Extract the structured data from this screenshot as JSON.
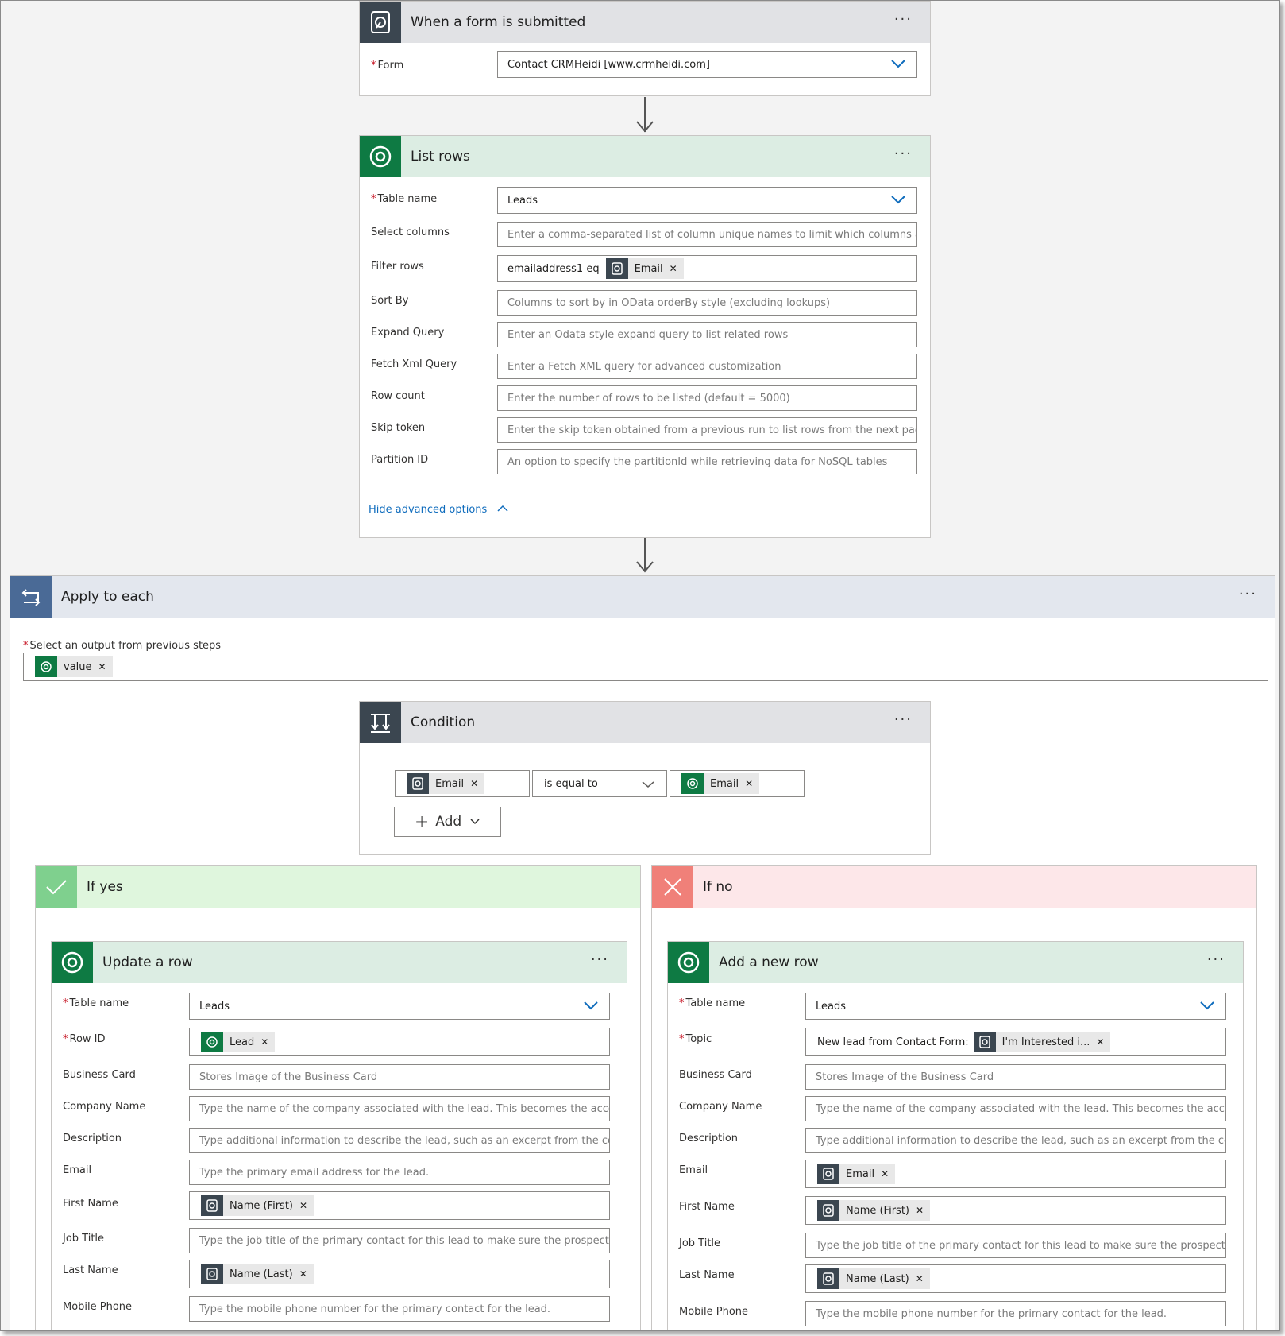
{
  "trigger": {
    "title": "When a form is submitted",
    "form_label": "Form",
    "form_value": "Contact CRMHeidi [www.crmheidi.com]"
  },
  "list_rows": {
    "title": "List rows",
    "table_label": "Table name",
    "table_value": "Leads",
    "select_columns_label": "Select columns",
    "select_columns_ph": "Enter a comma-separated list of column unique names to limit which columns a",
    "filter_label": "Filter rows",
    "filter_text": "emailaddress1 eq",
    "filter_token": "Email",
    "sort_label": "Sort By",
    "sort_ph": "Columns to sort by in OData orderBy style (excluding lookups)",
    "expand_label": "Expand Query",
    "expand_ph": "Enter an Odata style expand query to list related rows",
    "fetch_label": "Fetch Xml Query",
    "fetch_ph": "Enter a Fetch XML query for advanced customization",
    "rowcount_label": "Row count",
    "rowcount_ph": "Enter the number of rows to be listed (default = 5000)",
    "skip_label": "Skip token",
    "skip_ph": "Enter the skip token obtained from a previous run to list rows from the next pag",
    "partition_label": "Partition ID",
    "partition_ph": "An option to specify the partitionId while retrieving data for NoSQL tables",
    "hide_advanced": "Hide advanced options"
  },
  "apply": {
    "title": "Apply to each",
    "select_label": "Select an output from previous steps",
    "value_token": "value"
  },
  "condition": {
    "title": "Condition",
    "left_token": "Email",
    "operator": "is equal to",
    "right_token": "Email",
    "add_label": "Add"
  },
  "if_yes": {
    "title": "If yes",
    "update": {
      "title": "Update a row",
      "table_label": "Table name",
      "table_value": "Leads",
      "rowid_label": "Row ID",
      "rowid_token": "Lead",
      "bcard_label": "Business Card",
      "bcard_ph": "Stores Image of the Business Card",
      "company_label": "Company Name",
      "company_ph": "Type the name of the company associated with the lead. This becomes the acco",
      "desc_label": "Description",
      "desc_ph": "Type additional information to describe the lead, such as an excerpt from the cc",
      "email_label": "Email",
      "email_ph": "Type the primary email address for the lead.",
      "first_label": "First Name",
      "first_token": "Name (First)",
      "job_label": "Job Title",
      "job_ph": "Type the job title of the primary contact for this lead to make sure the prospect",
      "last_label": "Last Name",
      "last_token": "Name (Last)",
      "mobile_label": "Mobile Phone",
      "mobile_ph": "Type the mobile phone number for the primary contact for the lead."
    }
  },
  "if_no": {
    "title": "If no",
    "add": {
      "title": "Add a new row",
      "table_label": "Table name",
      "table_value": "Leads",
      "topic_label": "Topic",
      "topic_text": "New lead from Contact Form:",
      "topic_token": "I'm Interested i...",
      "bcard_label": "Business Card",
      "bcard_ph": "Stores Image of the Business Card",
      "company_label": "Company Name",
      "company_ph": "Type the name of the company associated with the lead. This becomes the acco",
      "desc_label": "Description",
      "desc_ph": "Type additional information to describe the lead, such as an excerpt from the cc",
      "email_label": "Email",
      "email_token": "Email",
      "first_label": "First Name",
      "first_token": "Name (First)",
      "job_label": "Job Title",
      "job_ph": "Type the job title of the primary contact for this lead to make sure the prospect",
      "last_label": "Last Name",
      "last_token": "Name (Last)",
      "mobile_label": "Mobile Phone",
      "mobile_ph": "Type the mobile phone number for the primary contact for the lead."
    }
  },
  "icons": {
    "more": "more-options-icon",
    "close": "remove-token-icon",
    "chevron": "chevron-down-icon"
  },
  "colors": {
    "dataverse_green": "#0e7a43",
    "forms_dark": "#3b4650",
    "loop_blue": "#4a6a96",
    "yes_green": "#7fd08e",
    "no_red": "#f08079",
    "link_blue": "#0f6cbd"
  }
}
